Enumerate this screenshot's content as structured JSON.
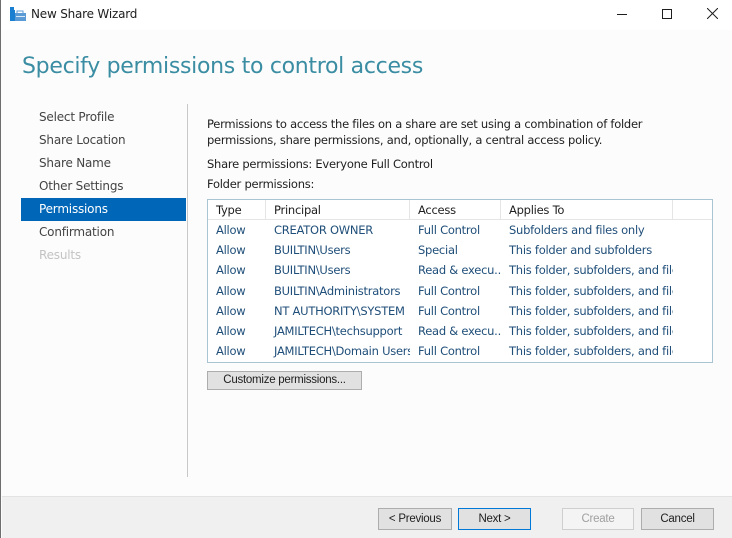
{
  "window": {
    "title": "New Share Wizard",
    "controls": {
      "minimize": "minimize-icon",
      "maximize": "maximize-icon",
      "close": "close-icon"
    }
  },
  "page": {
    "heading": "Specify permissions to control access"
  },
  "nav": {
    "items": [
      {
        "label": "Select Profile",
        "state": "normal"
      },
      {
        "label": "Share Location",
        "state": "normal"
      },
      {
        "label": "Share Name",
        "state": "normal"
      },
      {
        "label": "Other Settings",
        "state": "normal"
      },
      {
        "label": "Permissions",
        "state": "active"
      },
      {
        "label": "Confirmation",
        "state": "normal"
      },
      {
        "label": "Results",
        "state": "disabled"
      }
    ]
  },
  "content": {
    "description": "Permissions to access the files on a share are set using a combination of folder permissions, share permissions, and, optionally, a central access policy.",
    "share_permissions": "Share permissions: Everyone Full Control",
    "folder_permissions_label": "Folder permissions:",
    "table": {
      "columns": [
        "Type",
        "Principal",
        "Access",
        "Applies To"
      ],
      "rows": [
        [
          "Allow",
          "CREATOR OWNER",
          "Full Control",
          "Subfolders and files only"
        ],
        [
          "Allow",
          "BUILTIN\\Users",
          "Special",
          "This folder and subfolders"
        ],
        [
          "Allow",
          "BUILTIN\\Users",
          "Read & execu...",
          "This folder, subfolders, and files"
        ],
        [
          "Allow",
          "BUILTIN\\Administrators",
          "Full Control",
          "This folder, subfolders, and files"
        ],
        [
          "Allow",
          "NT AUTHORITY\\SYSTEM",
          "Full Control",
          "This folder, subfolders, and files"
        ],
        [
          "Allow",
          "JAMILTECH\\techsupport",
          "Read & execu...",
          "This folder, subfolders, and files"
        ],
        [
          "Allow",
          "JAMILTECH\\Domain Users",
          "Full Control",
          "This folder, subfolders, and files"
        ]
      ]
    },
    "customize_button": "Customize permissions..."
  },
  "footer": {
    "previous": "< Previous",
    "next": "Next >",
    "create": "Create",
    "cancel": "Cancel"
  },
  "colors": {
    "accent": "#0067b8",
    "heading": "#3a8da2",
    "row_text": "#1f4e79"
  }
}
